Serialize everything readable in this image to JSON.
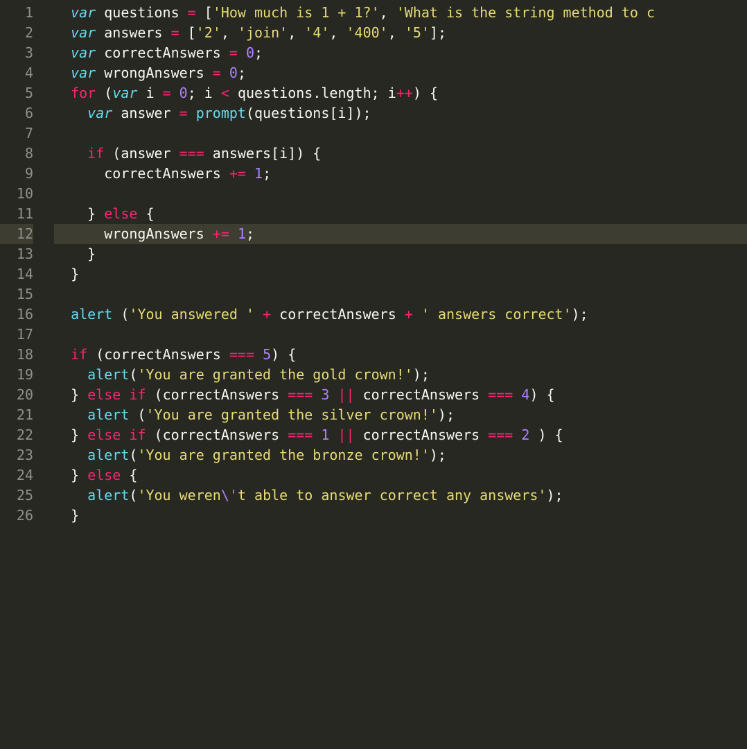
{
  "gutter": {
    "start": 1,
    "end": 26,
    "highlight": 12
  },
  "code": {
    "lines": [
      {
        "n": 1,
        "indent": 2,
        "tokens": [
          [
            "st",
            "var"
          ],
          [
            "id",
            " questions "
          ],
          [
            "op",
            "="
          ],
          [
            "id",
            " ["
          ],
          [
            "str",
            "'How much is 1 + 1?'"
          ],
          [
            "id",
            ", "
          ],
          [
            "str",
            "'What is the string method to c"
          ]
        ]
      },
      {
        "n": 2,
        "indent": 2,
        "tokens": [
          [
            "st",
            "var"
          ],
          [
            "id",
            " answers "
          ],
          [
            "op",
            "="
          ],
          [
            "id",
            " ["
          ],
          [
            "str",
            "'2'"
          ],
          [
            "id",
            ", "
          ],
          [
            "str",
            "'join'"
          ],
          [
            "id",
            ", "
          ],
          [
            "str",
            "'4'"
          ],
          [
            "id",
            ", "
          ],
          [
            "str",
            "'400'"
          ],
          [
            "id",
            ", "
          ],
          [
            "str",
            "'5'"
          ],
          [
            "id",
            "];"
          ]
        ]
      },
      {
        "n": 3,
        "indent": 2,
        "tokens": [
          [
            "st",
            "var"
          ],
          [
            "id",
            " correctAnswers "
          ],
          [
            "op",
            "="
          ],
          [
            "id",
            " "
          ],
          [
            "num",
            "0"
          ],
          [
            "id",
            ";"
          ]
        ]
      },
      {
        "n": 4,
        "indent": 2,
        "tokens": [
          [
            "st",
            "var"
          ],
          [
            "id",
            " wrongAnswers "
          ],
          [
            "op",
            "="
          ],
          [
            "id",
            " "
          ],
          [
            "num",
            "0"
          ],
          [
            "id",
            ";"
          ]
        ]
      },
      {
        "n": 5,
        "indent": 2,
        "tokens": [
          [
            "kw",
            "for"
          ],
          [
            "id",
            " ("
          ],
          [
            "st",
            "var"
          ],
          [
            "id",
            " i "
          ],
          [
            "op",
            "="
          ],
          [
            "id",
            " "
          ],
          [
            "num",
            "0"
          ],
          [
            "id",
            "; i "
          ],
          [
            "op",
            "<"
          ],
          [
            "id",
            " questions.length; i"
          ],
          [
            "op",
            "++"
          ],
          [
            "id",
            ") {"
          ]
        ]
      },
      {
        "n": 6,
        "indent": 4,
        "tokens": [
          [
            "st",
            "var"
          ],
          [
            "id",
            " answer "
          ],
          [
            "op",
            "="
          ],
          [
            "id",
            " "
          ],
          [
            "fn",
            "prompt"
          ],
          [
            "id",
            "(questions[i]);"
          ]
        ]
      },
      {
        "n": 7,
        "indent": 0,
        "tokens": []
      },
      {
        "n": 8,
        "indent": 4,
        "tokens": [
          [
            "kw",
            "if"
          ],
          [
            "id",
            " (answer "
          ],
          [
            "op",
            "==="
          ],
          [
            "id",
            " answers[i]) {"
          ]
        ]
      },
      {
        "n": 9,
        "indent": 6,
        "tokens": [
          [
            "id",
            "correctAnswers "
          ],
          [
            "op",
            "+="
          ],
          [
            "id",
            " "
          ],
          [
            "num",
            "1"
          ],
          [
            "id",
            ";"
          ]
        ]
      },
      {
        "n": 10,
        "indent": 0,
        "tokens": []
      },
      {
        "n": 11,
        "indent": 4,
        "tokens": [
          [
            "id",
            "} "
          ],
          [
            "kw",
            "else"
          ],
          [
            "id",
            " {"
          ]
        ]
      },
      {
        "n": 12,
        "indent": 6,
        "hl": true,
        "tokens": [
          [
            "id",
            "wrongAnswers "
          ],
          [
            "op",
            "+="
          ],
          [
            "id",
            " "
          ],
          [
            "num",
            "1"
          ],
          [
            "id",
            ";"
          ]
        ]
      },
      {
        "n": 13,
        "indent": 4,
        "tokens": [
          [
            "id",
            "}"
          ]
        ]
      },
      {
        "n": 14,
        "indent": 2,
        "tokens": [
          [
            "id",
            "}"
          ]
        ]
      },
      {
        "n": 15,
        "indent": 0,
        "tokens": []
      },
      {
        "n": 16,
        "indent": 2,
        "tokens": [
          [
            "fn",
            "alert"
          ],
          [
            "id",
            " ("
          ],
          [
            "str",
            "'You answered '"
          ],
          [
            "id",
            " "
          ],
          [
            "op",
            "+"
          ],
          [
            "id",
            " correctAnswers "
          ],
          [
            "op",
            "+"
          ],
          [
            "id",
            " "
          ],
          [
            "str",
            "' answers correct'"
          ],
          [
            "id",
            ");"
          ]
        ]
      },
      {
        "n": 17,
        "indent": 0,
        "tokens": []
      },
      {
        "n": 18,
        "indent": 2,
        "tokens": [
          [
            "kw",
            "if"
          ],
          [
            "id",
            " (correctAnswers "
          ],
          [
            "op",
            "==="
          ],
          [
            "id",
            " "
          ],
          [
            "num",
            "5"
          ],
          [
            "id",
            ") {"
          ]
        ]
      },
      {
        "n": 19,
        "indent": 4,
        "tokens": [
          [
            "fn",
            "alert"
          ],
          [
            "id",
            "("
          ],
          [
            "str",
            "'You are granted the gold crown!'"
          ],
          [
            "id",
            ");"
          ]
        ]
      },
      {
        "n": 20,
        "indent": 2,
        "tokens": [
          [
            "id",
            "} "
          ],
          [
            "kw",
            "else"
          ],
          [
            "id",
            " "
          ],
          [
            "kw",
            "if"
          ],
          [
            "id",
            " (correctAnswers "
          ],
          [
            "op",
            "==="
          ],
          [
            "id",
            " "
          ],
          [
            "num",
            "3"
          ],
          [
            "id",
            " "
          ],
          [
            "op",
            "||"
          ],
          [
            "id",
            " correctAnswers "
          ],
          [
            "op",
            "==="
          ],
          [
            "id",
            " "
          ],
          [
            "num",
            "4"
          ],
          [
            "id",
            ") {"
          ]
        ]
      },
      {
        "n": 21,
        "indent": 4,
        "tokens": [
          [
            "fn",
            "alert"
          ],
          [
            "id",
            " ("
          ],
          [
            "str",
            "'You are granted the silver crown!'"
          ],
          [
            "id",
            ");"
          ]
        ]
      },
      {
        "n": 22,
        "indent": 2,
        "tokens": [
          [
            "id",
            "} "
          ],
          [
            "kw",
            "else"
          ],
          [
            "id",
            " "
          ],
          [
            "kw",
            "if"
          ],
          [
            "id",
            " (correctAnswers "
          ],
          [
            "op",
            "==="
          ],
          [
            "id",
            " "
          ],
          [
            "num",
            "1"
          ],
          [
            "id",
            " "
          ],
          [
            "op",
            "||"
          ],
          [
            "id",
            " correctAnswers "
          ],
          [
            "op",
            "==="
          ],
          [
            "id",
            " "
          ],
          [
            "num",
            "2"
          ],
          [
            "id",
            " ) {"
          ]
        ]
      },
      {
        "n": 23,
        "indent": 4,
        "tokens": [
          [
            "fn",
            "alert"
          ],
          [
            "id",
            "("
          ],
          [
            "str",
            "'You are granted the bronze crown!'"
          ],
          [
            "id",
            ");"
          ]
        ]
      },
      {
        "n": 24,
        "indent": 2,
        "tokens": [
          [
            "id",
            "} "
          ],
          [
            "kw",
            "else"
          ],
          [
            "id",
            " {"
          ]
        ]
      },
      {
        "n": 25,
        "indent": 4,
        "tokens": [
          [
            "fn",
            "alert"
          ],
          [
            "id",
            "("
          ],
          [
            "str",
            "'You weren"
          ],
          [
            "esc",
            "\\'"
          ],
          [
            "str",
            "t able to answer correct any answers'"
          ],
          [
            "id",
            ");"
          ]
        ]
      },
      {
        "n": 26,
        "indent": 2,
        "tokens": [
          [
            "id",
            "}"
          ]
        ]
      }
    ]
  }
}
